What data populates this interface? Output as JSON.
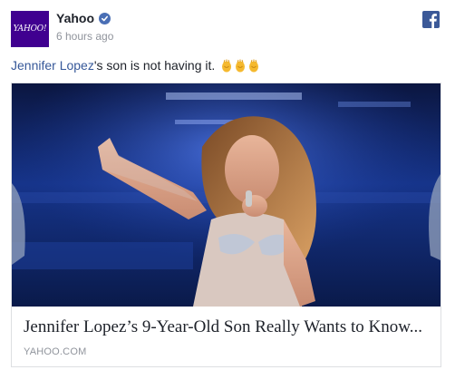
{
  "post": {
    "avatar_text": "YAHOO!",
    "author": "Yahoo",
    "time": "6 hours ago",
    "message": {
      "mention": "Jennifer Lopez",
      "text": "'s son is not having it."
    }
  },
  "card": {
    "title": "Jennifer Lopez’s 9-Year-Old Son Really Wants to Know...",
    "source": "YAHOO.COM",
    "image_description": "jennifer-lopez-performing"
  },
  "icons": {
    "verified": "verified-badge-icon",
    "facebook": "facebook-logo-icon",
    "claps": "clapping-hands-emoji"
  },
  "colors": {
    "yahoo_purple": "#400090",
    "facebook_blue": "#3b5998",
    "link_blue": "#365899",
    "meta_gray": "#90949c"
  }
}
